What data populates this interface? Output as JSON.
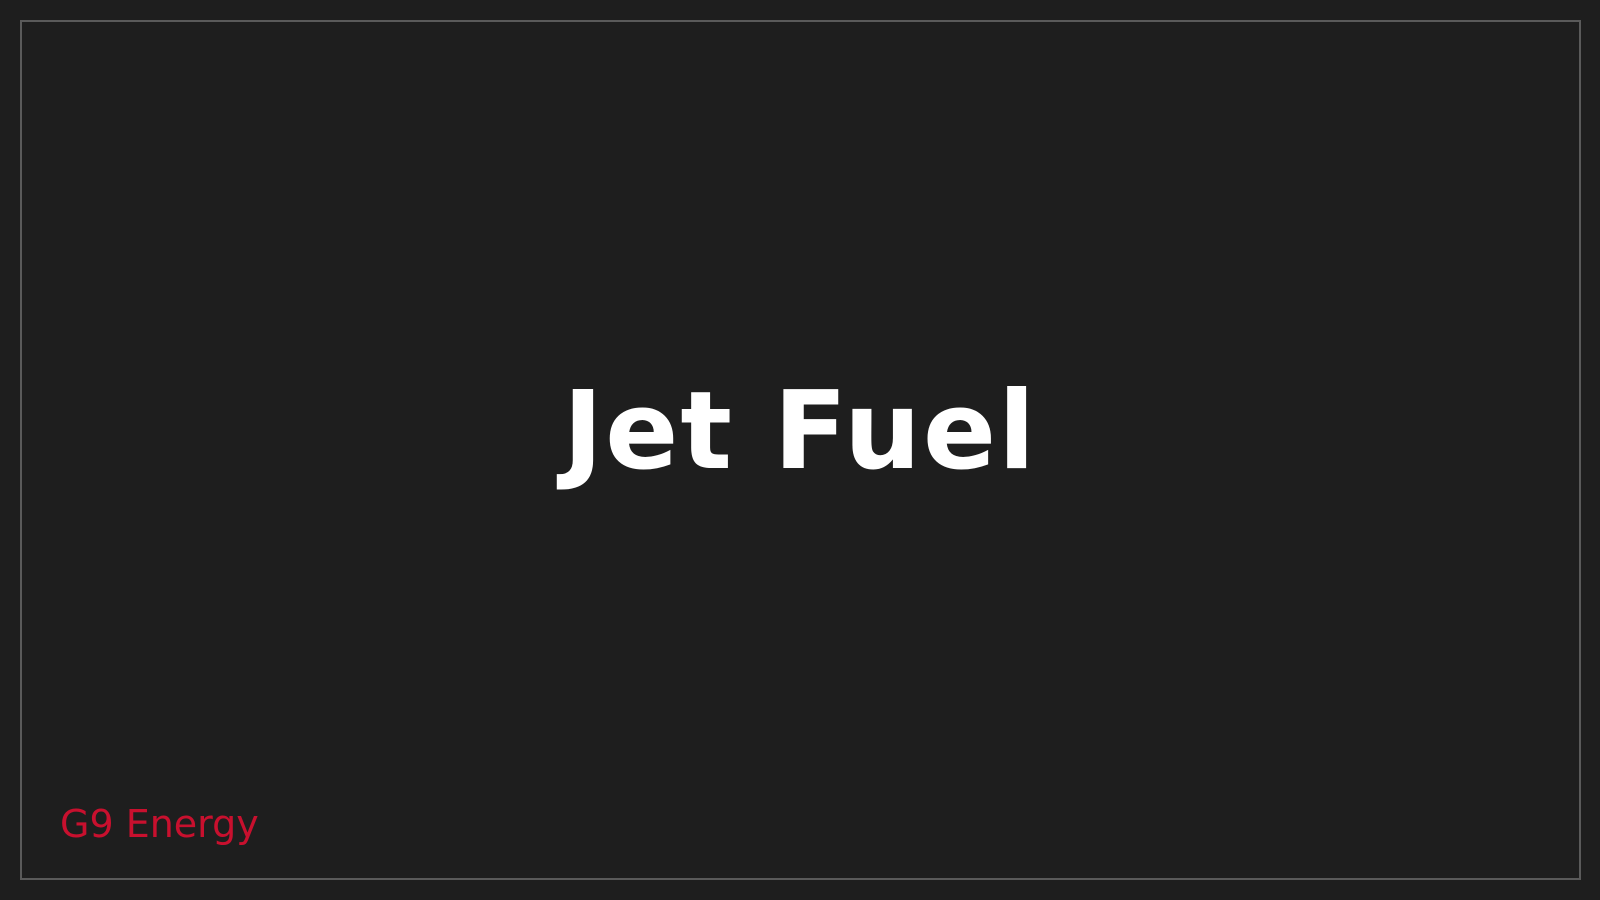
{
  "slide": {
    "title": "Jet Fuel",
    "brand": "G9 Energy"
  },
  "colors": {
    "background": "#1e1e1e",
    "frame_border": "#5a5a5a",
    "title_text": "#ffffff",
    "brand_text": "#c8102e"
  }
}
